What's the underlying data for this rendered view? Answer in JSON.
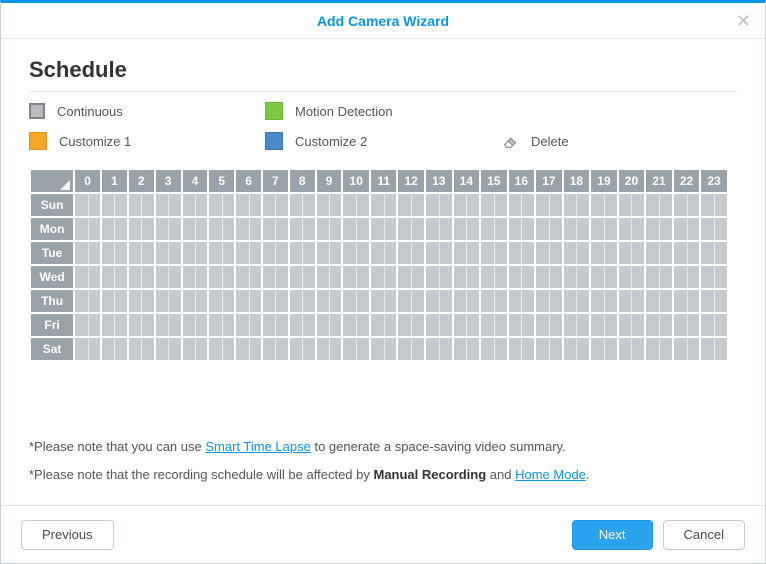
{
  "window": {
    "title": "Add Camera Wizard"
  },
  "page": {
    "heading": "Schedule"
  },
  "legend": {
    "continuous": "Continuous",
    "motion": "Motion Detection",
    "customize1": "Customize 1",
    "customize2": "Customize 2",
    "delete": "Delete"
  },
  "schedule": {
    "hours": [
      "0",
      "1",
      "2",
      "3",
      "4",
      "5",
      "6",
      "7",
      "8",
      "9",
      "10",
      "11",
      "12",
      "13",
      "14",
      "15",
      "16",
      "17",
      "18",
      "19",
      "20",
      "21",
      "22",
      "23"
    ],
    "days": [
      "Sun",
      "Mon",
      "Tue",
      "Wed",
      "Thu",
      "Fri",
      "Sat"
    ]
  },
  "notes": {
    "line1_prefix": "*Please note that you can use ",
    "line1_link": "Smart Time Lapse",
    "line1_suffix": " to generate a space-saving video summary.",
    "line2_prefix": "*Please note that the recording schedule will be affected by ",
    "line2_bold": "Manual Recording",
    "line2_mid": " and ",
    "line2_link": "Home Mode",
    "line2_end": "."
  },
  "buttons": {
    "previous": "Previous",
    "next": "Next",
    "cancel": "Cancel"
  },
  "colors": {
    "accent": "#0a94e5",
    "swatch_continuous": "#b9bcbf",
    "swatch_motion": "#7ac943",
    "swatch_customize1": "#f5a623",
    "swatch_customize2": "#4a8ac9",
    "grid_header": "#9aa2a9",
    "grid_cell": "#c5cacf"
  }
}
